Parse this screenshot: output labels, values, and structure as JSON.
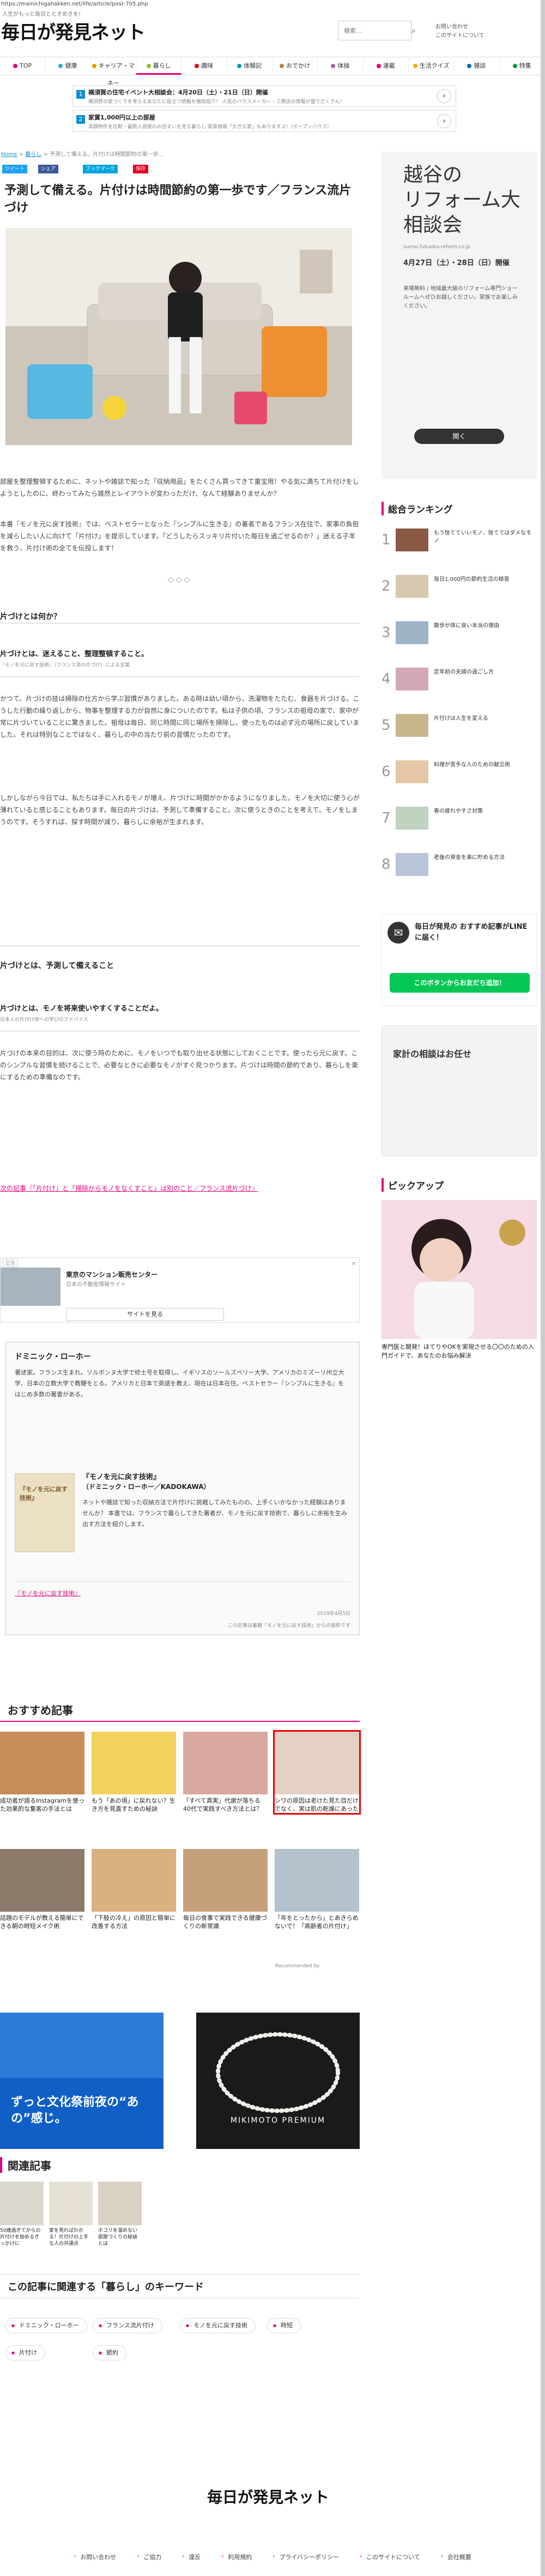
{
  "url": "https://mainichigahakken.net/life/article/post-705.php",
  "header": {
    "tagline": "人生がもっと毎日とときめきを!",
    "logo": "毎日が発見ネット",
    "search_placeholder": "検索...",
    "links": [
      "お問い合わせ",
      "このサイトについて"
    ]
  },
  "nav": [
    {
      "label": "TOP",
      "color": "#e4007f"
    },
    {
      "label": "健康",
      "color": "#2ea7e0"
    },
    {
      "label": "キャリア・マネー",
      "color": "#f39800"
    },
    {
      "label": "暮らし",
      "color": "#8dc21f"
    },
    {
      "label": "趣味",
      "color": "#e60012"
    },
    {
      "label": "体験記",
      "color": "#00a0a0"
    },
    {
      "label": "おでかけ",
      "color": "#b28247"
    },
    {
      "label": "体操",
      "color": "#a864a8"
    },
    {
      "label": "連載",
      "color": "#e4007f"
    },
    {
      "label": "生活クイズ",
      "color": "#f6ab00"
    },
    {
      "label": "雑誌",
      "color": "#0068b7"
    },
    {
      "label": "特集",
      "color": "#009944"
    }
  ],
  "news": [
    {
      "num": "1",
      "title": "横須賀の住宅イベント大相談会：4月20日（土）・21日（日）開催",
      "sub": "横須賀の家づくりを考えるあなたに役立つ情報を徹底紹介！ 人気のハウスメーカー・工務店の情報が盛りだくさん！"
    },
    {
      "num": "2",
      "title": "家賃1,000円以上の部屋",
      "sub": "高額物件を比較・最新入居者のお住まいを見る暮らし 家賃相場「大きな家」もありますよ!（オープンハウス）"
    }
  ],
  "breadcrumb": {
    "home": "Home",
    "cat": "暮らし",
    "rest": "予測して備える。片付けは時間節約の第一歩..."
  },
  "share": [
    {
      "label": "ツイート",
      "color": "#1da1f2"
    },
    {
      "label": "シェア",
      "color": "#3b5998"
    },
    {
      "label": "ブックマーク",
      "color": "#00a4de"
    },
    {
      "label": "保存",
      "color": "#e60023"
    }
  ],
  "article": {
    "title": "予測して備える。片付けは時間節約の第一歩です／フランス流片づけ",
    "intro": "部屋を整理整頓するために、ネットや雑誌で知った「収納用品」をたくさん買ってきて重宝用！やる気に満ちて片付けをしようとしたのに、終わってみたら雑然とレイアウトが変わっただけ、なんて経験ありませんか？",
    "intro2": "本書『モノを元に戻す技術』では、ベストセラーとなった『シンプルに生きる』の著者であるフランス在住で、家事の負担を減らしたい人に向けて「片付け」を提示しています。「どうしたらスッキリ片付いた毎日を過ごせるのか？」迷える子羊を救う、片付け術の全てを伝授します！",
    "divider": "◇◇◇",
    "h1": "片づけとは何か？",
    "q1": "片づけとは、迷えること、整理整頓すること。",
    "q1src": "『モノを元に戻す技術』（フランス流の片づけ）による言葉",
    "p1": "かつて、片づけの技は掃除の仕方から学ぶ習慣がありました。ある時は幼い頃から、洗濯物をたたむ、食器を片づける。こうした行動の繰り返しから、物事を整理する力が自然に身についたのです。私は子供の頃、フランスの祖母の家で、家中が常に片づいていることに驚きました。祖母は毎日、同じ時間に同じ場所を掃除し、使ったものは必ず元の場所に戻していました。それは特別なことではなく、暮らしの中の当たり前の習慣だったのです。",
    "p2": "しかしながら今日では、私たちは手に入れるモノが増え、片づけに時間がかかるようになりました。モノを大切に使う心が薄れていると感じることもあります。毎日の片づけは、予測して準備すること。次に使うときのことを考えて、モノをしまうのです。そうすれば、探す時間が減り、暮らしに余裕が生まれます。",
    "h2": "片づけとは、予測して備えること",
    "q2": "片づけとは、モノを将来使いやすくすることだよ。",
    "q2src": "日本人の片付け術への学びのアドバイス",
    "p3": "片づけの本来の目的は、次に使う時のために、モノをいつでも取り出せる状態にしておくことです。使ったら元に戻す。このシンプルな習慣を続けることで、必要なときに必要なモノがすぐ見つかります。片づけは時間の節約であり、暮らしを楽にするための準備なのです。",
    "link": "次の記事『「片付け」と「掃除からモノをなくすこと」は別のこと／フランス流片づけ』"
  },
  "ad": {
    "label": "広告",
    "title": "東京のマンション販売センター",
    "sub": "日本の不動産情報サイト",
    "cta": "サイトを見る"
  },
  "author": {
    "name": "ドミニック・ローホー",
    "bio": "著述家。フランス生まれ。ソルボンヌ大学で修士号を取得し、イギリスのソールズベリー大学、アメリカのミズーリ州立大学、日本の立教大学で教鞭をとる。アメリカと日本で英語を教え、現在は日本在住。ベストセラー『シンプルに生きる』をはじめ多数の著書がある。",
    "book_title": "『モノを元に戻す技術』",
    "book_author": "（ドミニック・ローホー／KADOKAWA）",
    "book_desc": "ネットや雑誌で知った収納方法で片付けに挑戦してみたものの、上手くいかなかった経験はありませんか？ 本書では、フランスで暮らしてきた著者が、モノを元に戻す技術で、暮らしに余裕を生み出す方法を紹介します。",
    "book_link": "『モノを元に戻す技術』",
    "date": "2019年4月5日",
    "credit": "この記事は書籍『モノを元に戻す技術』からの抜粋です"
  },
  "reco": {
    "heading": "おすすめ記事",
    "items": [
      {
        "cap": "成功者が語るInstagramを使った効果的な集客の手法とは"
      },
      {
        "cap": "もう「あの頃」に戻れない？生き方を見直すための秘訣"
      },
      {
        "cap": "「すべて真実」代謝が落ちる40代で実践すべき方法とは？"
      },
      {
        "cap": "シワの原因は老けた見た目だけでなく、実は肌の乾燥にあった"
      },
      {
        "cap": "話題のモデルが教える簡単にできる朝の時短メイク術"
      },
      {
        "cap": "「下肢の冷え」の原因と簡単に改善する方法"
      },
      {
        "cap": "毎日の食事で実践できる健康づくりの新常識"
      },
      {
        "cap": "「年をとったから」とあきらめないで！「高齢者の片付け」"
      }
    ],
    "sponsor": "Recommended by"
  },
  "banners": {
    "left": "ずっと文化祭前夜の“あの”感じ。",
    "right": "MIKIMOTO PREMIUM"
  },
  "related": {
    "heading": "関連記事",
    "items": [
      {
        "cap": "50歳過ぎてからの片付けを始めるきっかけに"
      },
      {
        "cap": "家を見ればわかる！片付けの上手な人の共通点"
      },
      {
        "cap": "ホコリを溜めない部屋づくりの秘訣とは"
      }
    ]
  },
  "keywords": {
    "heading": "この記事に関連する「暮らし」のキーワード",
    "tags": [
      "ドミニック・ローホー",
      "フランス流片付け",
      "モノを元に戻す技術",
      "時短",
      "片付け",
      "節約"
    ]
  },
  "sidebar": {
    "ad_title": "越谷の\nリフォーム大\n相談会",
    "ad_url": "sumai.fukuoka-reform.co.jp",
    "ad_date": "4月27日（土）・28日（日）開催",
    "ad_desc": "来場無料 / 地域最大級のリフォーム専門ショールームへぜひお越しください。家族でお楽しみください。",
    "ad_btn": "開く",
    "ranking_heading": "総合ランキング",
    "ranking": [
      "もう捨てていいモノ、捨ててはダメなモノ",
      "毎日1,000円の節約生活の極意",
      "散歩が体に良い本当の理由",
      "定年前の夫婦の過ごし方",
      "片付けは人生を変える",
      "料理が苦手な人のための献立術",
      "春の疲れやすさ対策",
      "老後の資金を楽に貯める方法"
    ],
    "line_title": "毎日が発見の おすすめ記事がLINEに届く！",
    "line_btn": "このボタンからお友だち追加！",
    "pickup_heading": "ピックアップ",
    "pickup_caption": "専門医と開発！ほてりやOKを実現させる〇〇のための入門ガイドで、あなたのお悩み解決",
    "sidebar_ad2": "家計の相談はお任せ"
  },
  "footer": {
    "logo": "毎日が発見ネット",
    "links": [
      "お問い合わせ",
      "ご協力",
      "違反",
      "利用規約",
      "プライバシーポリシー",
      "このサイトについて",
      "会社概要"
    ]
  }
}
